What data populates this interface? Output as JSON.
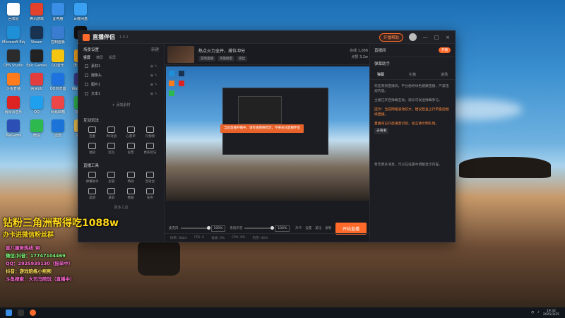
{
  "desktop": {
    "icons": [
      {
        "label": "回收站",
        "color": "#ffffff"
      },
      {
        "label": "Microsoft Edge",
        "color": "#1f8fd8"
      },
      {
        "label": "OBS Studio",
        "color": "#2b2b2b"
      },
      {
        "label": "斗鱼直播",
        "color": "#ff7b1c"
      },
      {
        "label": "网易云音乐",
        "color": "#dd2222"
      },
      {
        "label": "WeGame",
        "color": "#2c4fb5"
      },
      {
        "label": "腾讯游戏",
        "color": "#e3412c"
      },
      {
        "label": "Steam",
        "color": "#18324f"
      },
      {
        "label": "Epic Games",
        "color": "#222222"
      },
      {
        "label": "网易UU",
        "color": "#e33d3d"
      },
      {
        "label": "QQ",
        "color": "#1ea0ee"
      },
      {
        "label": "微信",
        "color": "#2db94d"
      },
      {
        "label": "此电脑",
        "color": "#3a8ee6"
      },
      {
        "label": "控制面板",
        "color": "#3a7cd0"
      },
      {
        "label": "QQ音乐",
        "color": "#f5c611"
      },
      {
        "label": "QQ浏览器",
        "color": "#1f73e0"
      },
      {
        "label": "网易邮箱",
        "color": "#ec4646"
      },
      {
        "label": "迅雷",
        "color": "#1c74d8"
      },
      {
        "label": "百度网盘",
        "color": "#3aa0f2"
      },
      {
        "label": "抖音",
        "color": "#111111"
      },
      {
        "label": "虎牙直播",
        "color": "#f5a623"
      },
      {
        "label": "Wallpaper",
        "color": "#3c3c8a"
      },
      {
        "label": "加速器",
        "color": "#2db94d"
      },
      {
        "label": "文件夹",
        "color": "#f2c14e"
      }
    ]
  },
  "app": {
    "title": "直播伴侣",
    "version": "1.0.1",
    "live_pill": "开播帮助",
    "window_controls": [
      "—",
      "□",
      "×"
    ],
    "left": {
      "scene_title": "场景设置",
      "scene_action": "新建",
      "tabs": [
        "竖屏",
        "横屏",
        "投屏"
      ],
      "scenes": [
        "素材1",
        "摄像头",
        "图片1",
        "文本1"
      ],
      "add_source": "+ 添加素材",
      "tools_title": "互动玩法",
      "tools": [
        "连麦",
        "PK对战",
        "心愿单",
        "礼物榜",
        "福袋",
        "红包",
        "投票",
        "更多玩法"
      ],
      "more_title": "直播工具",
      "more_tools": [
        "弹幕助手",
        "房管",
        "特效",
        "音效台",
        "美颜",
        "录屏",
        "数据",
        "任务"
      ],
      "more_label": "更多工具"
    },
    "center": {
      "stream_title": "热点火力全开，排位冲分",
      "tags": [
        "游戏直播",
        "英雄联盟",
        "排位"
      ],
      "viewers": "在线 1,088",
      "likes": "点赞 3.2w",
      "preview_alert": "当前直播开播中，请检查网络稳定，不要关闭直播伴侣",
      "mic_label": "麦克风",
      "mic_pct": "100%",
      "sys_label": "系统声音",
      "sys_pct": "100%",
      "ctrl_icons": [
        "声卡",
        "设置",
        "美化",
        "录制"
      ],
      "start_button": "开始直播",
      "status": [
        "码率: 0kb/s",
        "FPS: 0",
        "丢帧: 0%",
        "CPU: 9%",
        "内存: 45%"
      ]
    },
    "right": {
      "head_label": "直播间",
      "head_pill": "开播",
      "section": "弹幕助手",
      "tabs": [
        "弹幕",
        "礼物",
        "进场"
      ],
      "messages": [
        "欢迎来到直播间，平台倡导绿色健康直播，严禁违规内容。",
        "主播已开启弹幕互动，观众可发送弹幕参与。",
        "直播间已开启语音识别，发言请文明礼貌。"
      ],
      "warn_message": "提示：当前网络波动较大，建议检查上行带宽后继续直播。",
      "link_label": "去看看",
      "bottom_message": "暂无更多消息，可以在设置中调整显示内容。"
    }
  },
  "overlay": {
    "line1": "钻粉三角洲帮得吃1088w",
    "line2": "办卡进微信粉丝群",
    "lines": [
      {
        "text": "直八服务热线 ☎",
        "color": "#ff6ad8"
      },
      {
        "text": "微信/抖音：17747104469",
        "color": "#7dff7d"
      },
      {
        "text": "QQ：2925939130（接单中）",
        "color": "#ff6ad8"
      },
      {
        "text": "抖音：游戏陪练小熙熙",
        "color": "#ffe45a"
      },
      {
        "text": "斗鱼搜索：大司马陪玩（直播中）",
        "color": "#ff6ad8"
      }
    ]
  },
  "taskbar": {
    "time": "19:32",
    "date": "2025/3/25",
    "app_icon_colors": [
      "#3a8ee6",
      "#ff6a2a"
    ]
  }
}
